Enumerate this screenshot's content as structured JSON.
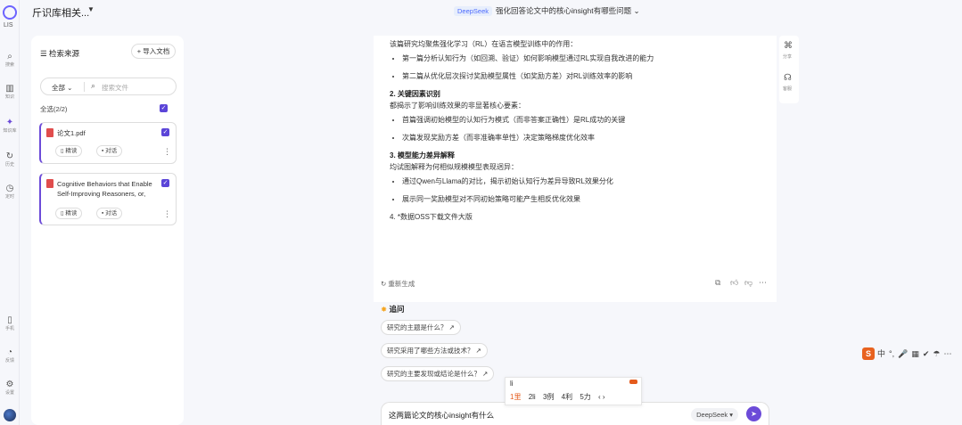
{
  "rail": {
    "logo_label": "LIS",
    "items": [
      {
        "icon": "search-icon",
        "glyph": "⌕",
        "label": "搜索"
      },
      {
        "icon": "library-icon",
        "glyph": "▥",
        "label": "知识"
      },
      {
        "icon": "knowledge-base-icon",
        "glyph": "✦",
        "label": "知识库"
      },
      {
        "icon": "history-icon",
        "glyph": "↻",
        "label": "历史"
      },
      {
        "icon": "clock-icon",
        "glyph": "◷",
        "label": "定时"
      },
      {
        "icon": "phone-icon",
        "glyph": "▯",
        "label": "手机"
      },
      {
        "icon": "feedback-icon",
        "glyph": "◔",
        "label": "反馈"
      },
      {
        "icon": "settings-icon",
        "glyph": "⚙",
        "label": "设置"
      }
    ]
  },
  "topbar": {
    "kb_title": "斤识库相关...",
    "center_badge": "DeepSeek",
    "center_title": "强化回答论文中的核心insight有哪些问题"
  },
  "left_panel": {
    "title": "☰ 检索来源",
    "upload_label": "导入文档",
    "scope_select": "全部",
    "search_placeholder": "搜索文件",
    "all_label": "全选(2/2)",
    "files": [
      {
        "name": "论文1.pdf",
        "chip1": "精读",
        "chip2": "对话"
      },
      {
        "name": "Cognitive Behaviors that Enable Self-Improving Reasoners, or,",
        "chip1": "精读",
        "chip2": "对话"
      }
    ]
  },
  "answer": {
    "intro": "该篇研究均聚焦强化学习（RL）在语言模型训练中的作用：",
    "bullets_1": [
      "第一篇分析认知行为（如回溯、验证）如何影响模型通过RL实现自我改进的能力",
      "第二篇从优化层次探讨奖励模型属性（如奖励方差）对RL训练效率的影响"
    ],
    "h2": "2. 关键因素识别",
    "p2": "都揭示了影响训练效果的非显著核心要素：",
    "bullets_2": [
      "首篇强调初始模型的认知行为模式（而非答案正确性）是RL成功的关键",
      "次篇发现奖励方差（而非准确率单性）决定策略梯度优化效率"
    ],
    "h3": "3. 模型能力差异解释",
    "p3": "均试图解释为何相似规模模型表现迥异：",
    "bullets_3": [
      "通过Qwen与Llama的对比，揭示初始认知行为差异导致RL效果分化",
      "展示同一奖励模型对不同初始策略可能产生相反优化效果"
    ],
    "p4": "4. *数据OSS下载文件大版",
    "regen_label": "重新生成",
    "follow_head": "追问",
    "follow_ups": [
      "研究的主题是什么？",
      "研究采用了哪些方法或技术？",
      "研究的主要发现或结论是什么？"
    ]
  },
  "input": {
    "text": "这两篇论文的核心insight有什么",
    "model_label": "DeepSeek",
    "model_caret": "▾"
  },
  "ime": {
    "composition": "li",
    "candidates": [
      "1里",
      "2li",
      "3例",
      "4利",
      "5力"
    ]
  },
  "side_tools": [
    {
      "icon": "share-icon",
      "glyph": "⌘",
      "label": "分享"
    },
    {
      "icon": "headset-icon",
      "glyph": "☊",
      "label": "客服"
    }
  ],
  "sogou": {
    "logo": "S",
    "items": [
      "中",
      "°,",
      "🎤",
      "▦",
      "✔",
      "☂",
      "⋯"
    ]
  }
}
